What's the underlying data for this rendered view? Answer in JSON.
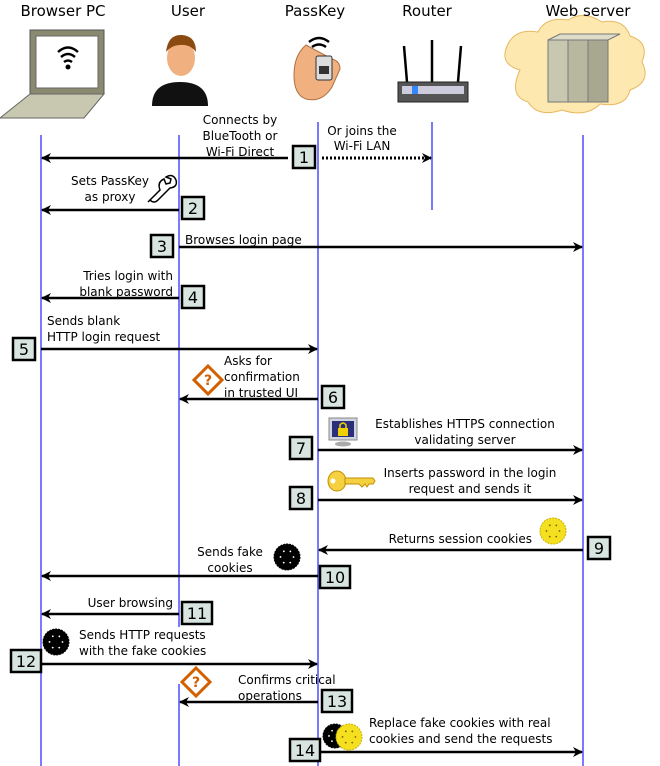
{
  "actors": [
    {
      "id": "browser",
      "label": "Browser PC",
      "icon": "laptop-wifi-icon"
    },
    {
      "id": "user",
      "label": "User",
      "icon": "user-avatar-icon"
    },
    {
      "id": "passkey",
      "label": "PassKey",
      "icon": "hand-holding-device-icon"
    },
    {
      "id": "router",
      "label": "Router",
      "icon": "wifi-router-icon"
    },
    {
      "id": "server",
      "label": "Web server",
      "icon": "cloud-server-icon"
    }
  ],
  "steps": [
    {
      "number": "1",
      "from": "passkey",
      "to": "browser",
      "lines": [
        "Connects by",
        "BlueTooth or",
        "Wi-Fi Direct"
      ]
    },
    {
      "number": "",
      "from": "passkey",
      "to": "router",
      "style": "dotted",
      "lines": [
        "Or joins the",
        "Wi-Fi LAN"
      ]
    },
    {
      "number": "2",
      "from": "user",
      "to": "browser",
      "lines": [
        "Sets PassKey",
        "as proxy"
      ],
      "icon": "wrench-icon"
    },
    {
      "number": "3",
      "from": "user",
      "to": "server",
      "lines": [
        "Browses login page"
      ]
    },
    {
      "number": "4",
      "from": "user",
      "to": "browser",
      "lines": [
        "Tries login with",
        "blank password"
      ]
    },
    {
      "number": "5",
      "from": "browser",
      "to": "passkey",
      "lines": [
        "Sends blank",
        "HTTP login request"
      ]
    },
    {
      "number": "6",
      "from": "passkey",
      "to": "user",
      "lines": [
        "Asks for",
        "confirmation",
        "in trusted UI"
      ],
      "icon": "warning-question-icon"
    },
    {
      "number": "7",
      "from": "passkey",
      "to": "server",
      "lines": [
        "Establishes HTTPS connection",
        "validating server"
      ],
      "icon": "secure-monitor-icon"
    },
    {
      "number": "8",
      "from": "passkey",
      "to": "server",
      "lines": [
        "Inserts password in the login",
        "request and sends it"
      ],
      "icon": "key-icon"
    },
    {
      "number": "9",
      "from": "server",
      "to": "passkey",
      "lines": [
        "Returns session cookies"
      ],
      "icon": "real-cookie-icon"
    },
    {
      "number": "10",
      "from": "passkey",
      "to": "browser",
      "lines": [
        "Sends fake",
        "cookies"
      ],
      "icon": "fake-cookie-icon"
    },
    {
      "number": "11",
      "from": "user",
      "to": "browser",
      "lines": [
        "User browsing"
      ]
    },
    {
      "number": "12",
      "from": "browser",
      "to": "passkey",
      "lines": [
        "Sends HTTP requests",
        "with the fake cookies"
      ],
      "icon": "fake-cookie-icon"
    },
    {
      "number": "13",
      "from": "passkey",
      "to": "user",
      "lines": [
        "Confirms critical",
        "operations"
      ],
      "icon": "warning-question-icon"
    },
    {
      "number": "14",
      "from": "passkey",
      "to": "server",
      "lines": [
        "Replace fake cookies with real",
        "cookies and send the requests"
      ],
      "icon": "cookie-swap-icon"
    }
  ],
  "colors": {
    "lifeline": "#3333ff",
    "box_fill": "#d8e4e0",
    "cookie_real": "#f5e020",
    "warning": "#d35f00"
  }
}
